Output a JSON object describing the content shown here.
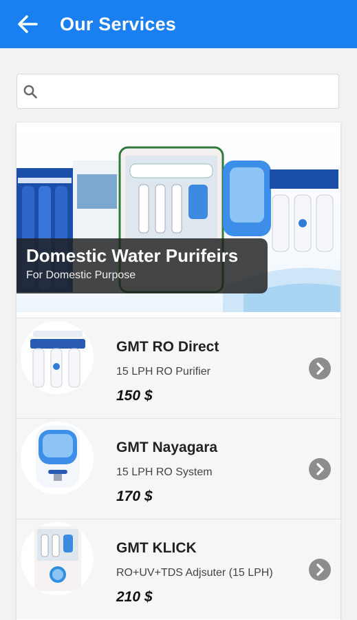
{
  "appbar": {
    "title": "Our Services",
    "back_icon": "arrow-left-icon",
    "color": "#1a7ff0"
  },
  "search": {
    "placeholder": "",
    "value": "",
    "icon": "search-icon"
  },
  "banner": {
    "title": "Domestic Water Purifeirs",
    "subtitle": "For Domestic Purpose"
  },
  "products": [
    {
      "name": "GMT RO Direct",
      "description": "15 LPH RO Purifier",
      "price": "150 $",
      "icon": "chevron-right-icon"
    },
    {
      "name": "GMT Nayagara",
      "description": "15 LPH RO System",
      "price": "170 $",
      "icon": "chevron-right-icon"
    },
    {
      "name": "GMT KLICK",
      "description": "RO+UV+TDS Adjsuter (15 LPH)",
      "price": "210 $",
      "icon": "chevron-right-icon"
    }
  ]
}
